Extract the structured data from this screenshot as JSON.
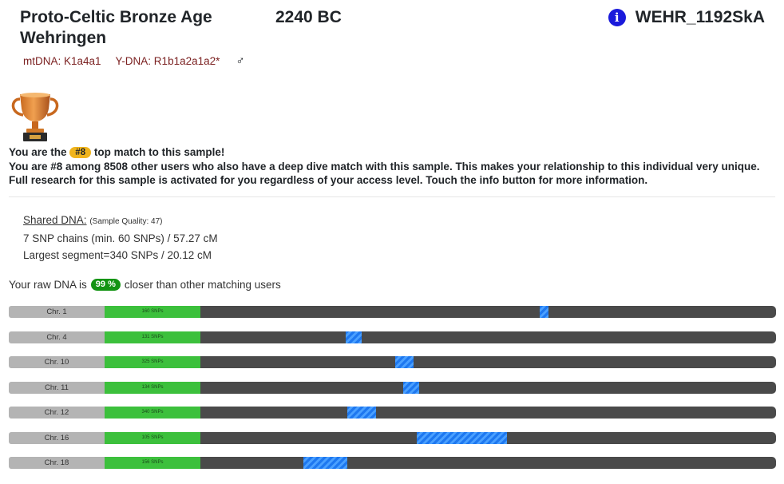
{
  "header": {
    "title": "Proto-Celtic Bronze Age Wehringen",
    "year": "2240 BC",
    "sample_id": "WEHR_1192SkA",
    "info_icon_glyph": "i"
  },
  "haplogroups": {
    "mtdna": "mtDNA: K1a4a1",
    "ydna": "Y-DNA: R1b1a2a1a2*",
    "sex_icon": "♂"
  },
  "match": {
    "line1_pre": "You are the",
    "rank_badge": "#8",
    "line1_post": "top match to this sample!",
    "line2": "You are #8 among 8508 other users who also have a deep dive match with this sample. This makes your relationship to this individual very unique.",
    "line3": "Full research for this sample is activated for you regardless of your access level. Touch the info button for more information."
  },
  "shared": {
    "heading": "Shared DNA:",
    "quality": "(Sample Quality: 47)",
    "chains": "7 SNP chains (min. 60 SNPs) / 57.27 cM",
    "largest": "Largest segment=340 SNPs / 20.12 cM"
  },
  "raw": {
    "pre": "Your raw DNA is",
    "percent": "99 %",
    "post": "closer than other matching users"
  },
  "colors": {
    "accent_blue": "#1e78f0",
    "snp_green": "#3cc03c",
    "track_gray": "#4a4a4a",
    "rank_yellow": "#f0b41c",
    "percent_green": "#149414",
    "haplo_red": "#7a1f1f"
  },
  "chromosomes": [
    {
      "label": "Chr. 1",
      "snps": "160 SNPs",
      "segment_start": 0.59,
      "segment_end": 0.605
    },
    {
      "label": "Chr. 4",
      "snps": "131 SNPs",
      "segment_start": 0.253,
      "segment_end": 0.28
    },
    {
      "label": "Chr. 10",
      "snps": "325 SNPs",
      "segment_start": 0.338,
      "segment_end": 0.37
    },
    {
      "label": "Chr. 11",
      "snps": "134 SNPs",
      "segment_start": 0.352,
      "segment_end": 0.38
    },
    {
      "label": "Chr. 12",
      "snps": "340 SNPs",
      "segment_start": 0.255,
      "segment_end": 0.305
    },
    {
      "label": "Chr. 16",
      "snps": "105 SNPs",
      "segment_start": 0.376,
      "segment_end": 0.533
    },
    {
      "label": "Chr. 18",
      "snps": "156 SNPs",
      "segment_start": 0.179,
      "segment_end": 0.255
    }
  ]
}
